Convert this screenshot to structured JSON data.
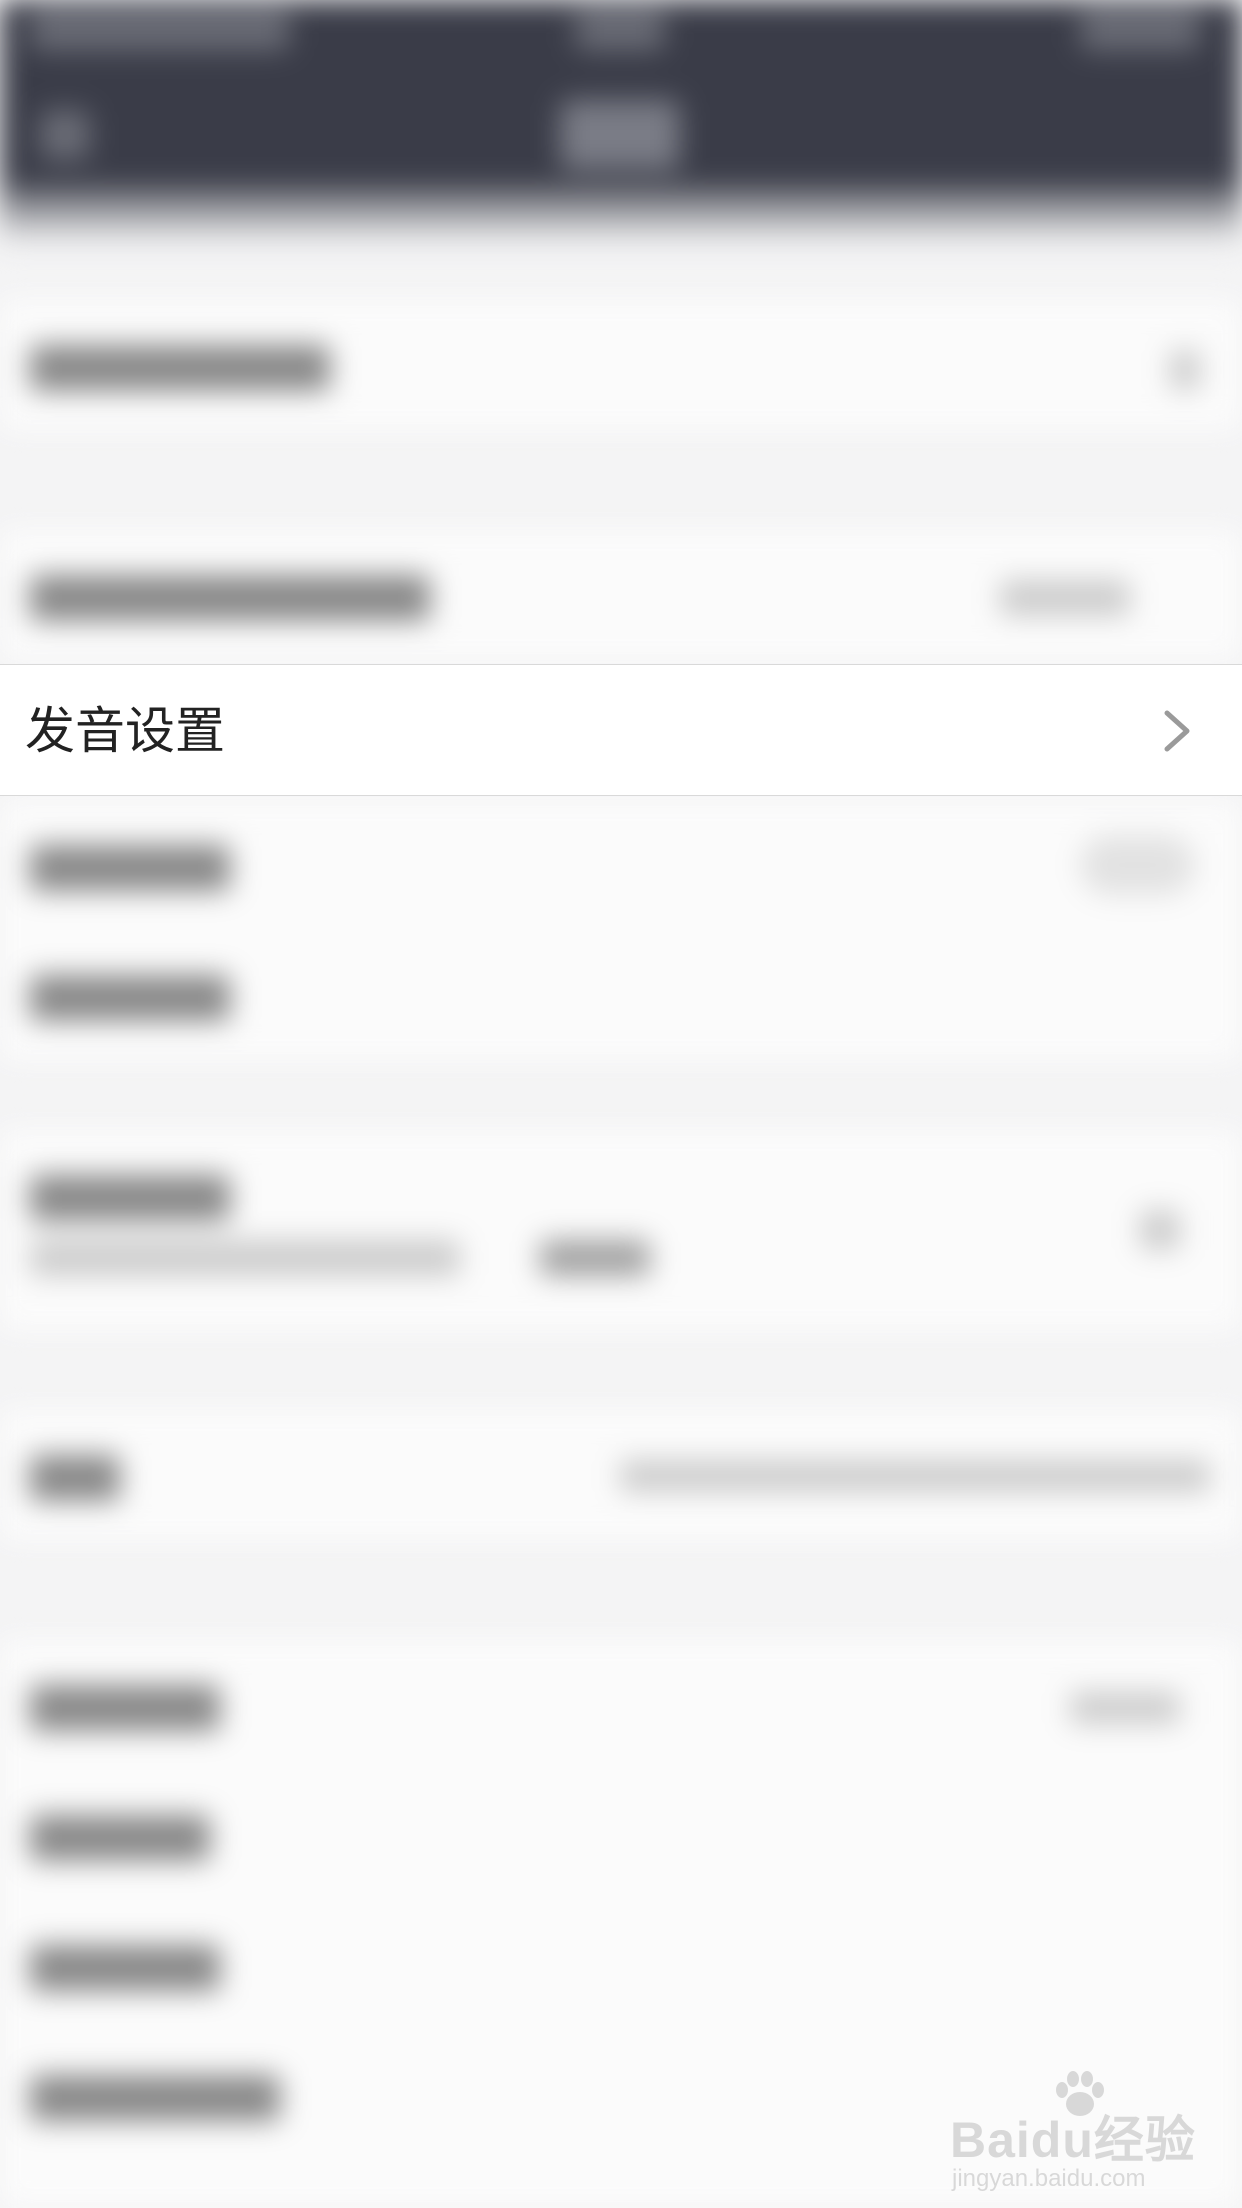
{
  "settings_row": {
    "label": "发音设置",
    "chevron_icon": "chevron-right-icon"
  },
  "watermark": {
    "brand": "Baidu经验",
    "url": "jingyan.baidu.com",
    "paw_icon": "baidu-paw-icon"
  },
  "colors": {
    "nav_bar": "#3a3c48",
    "page_background": "#f4f4f5",
    "row_background": "#ffffff",
    "label_text": "#222222",
    "chevron": "#9a9a9a",
    "divider": "#d9d9d9"
  }
}
